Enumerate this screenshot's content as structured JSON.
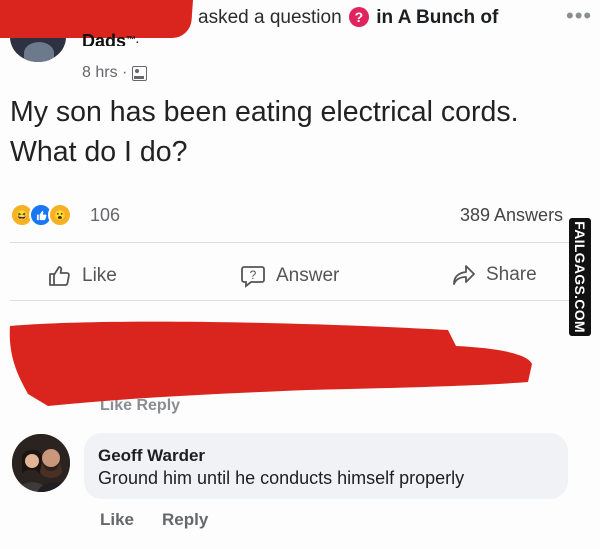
{
  "header": {
    "asked_text": "asked a question",
    "in_text": "in A Bunch of",
    "group_name_cont": "Dads",
    "trademark": "™.",
    "time": "8 hrs ·",
    "more_label": "•••"
  },
  "post": {
    "question": "My son has been eating electrical cords. What do I do?"
  },
  "reactions": {
    "count": "106",
    "answers": "389 Answers"
  },
  "actions": {
    "like": "Like",
    "answer": "Answer",
    "share": "Share"
  },
  "redacted_comment": {
    "actions": "Like   Reply"
  },
  "comment": {
    "author": "Geoff Warder",
    "text": "Ground him until he conducts himself properly",
    "like": "Like",
    "reply": "Reply"
  },
  "watermark": {
    "text": "FAILGAGS.COM"
  },
  "colors": {
    "redaction": "#d9251d",
    "question_badge": "#e0245e",
    "like_blue": "#1877f2"
  }
}
